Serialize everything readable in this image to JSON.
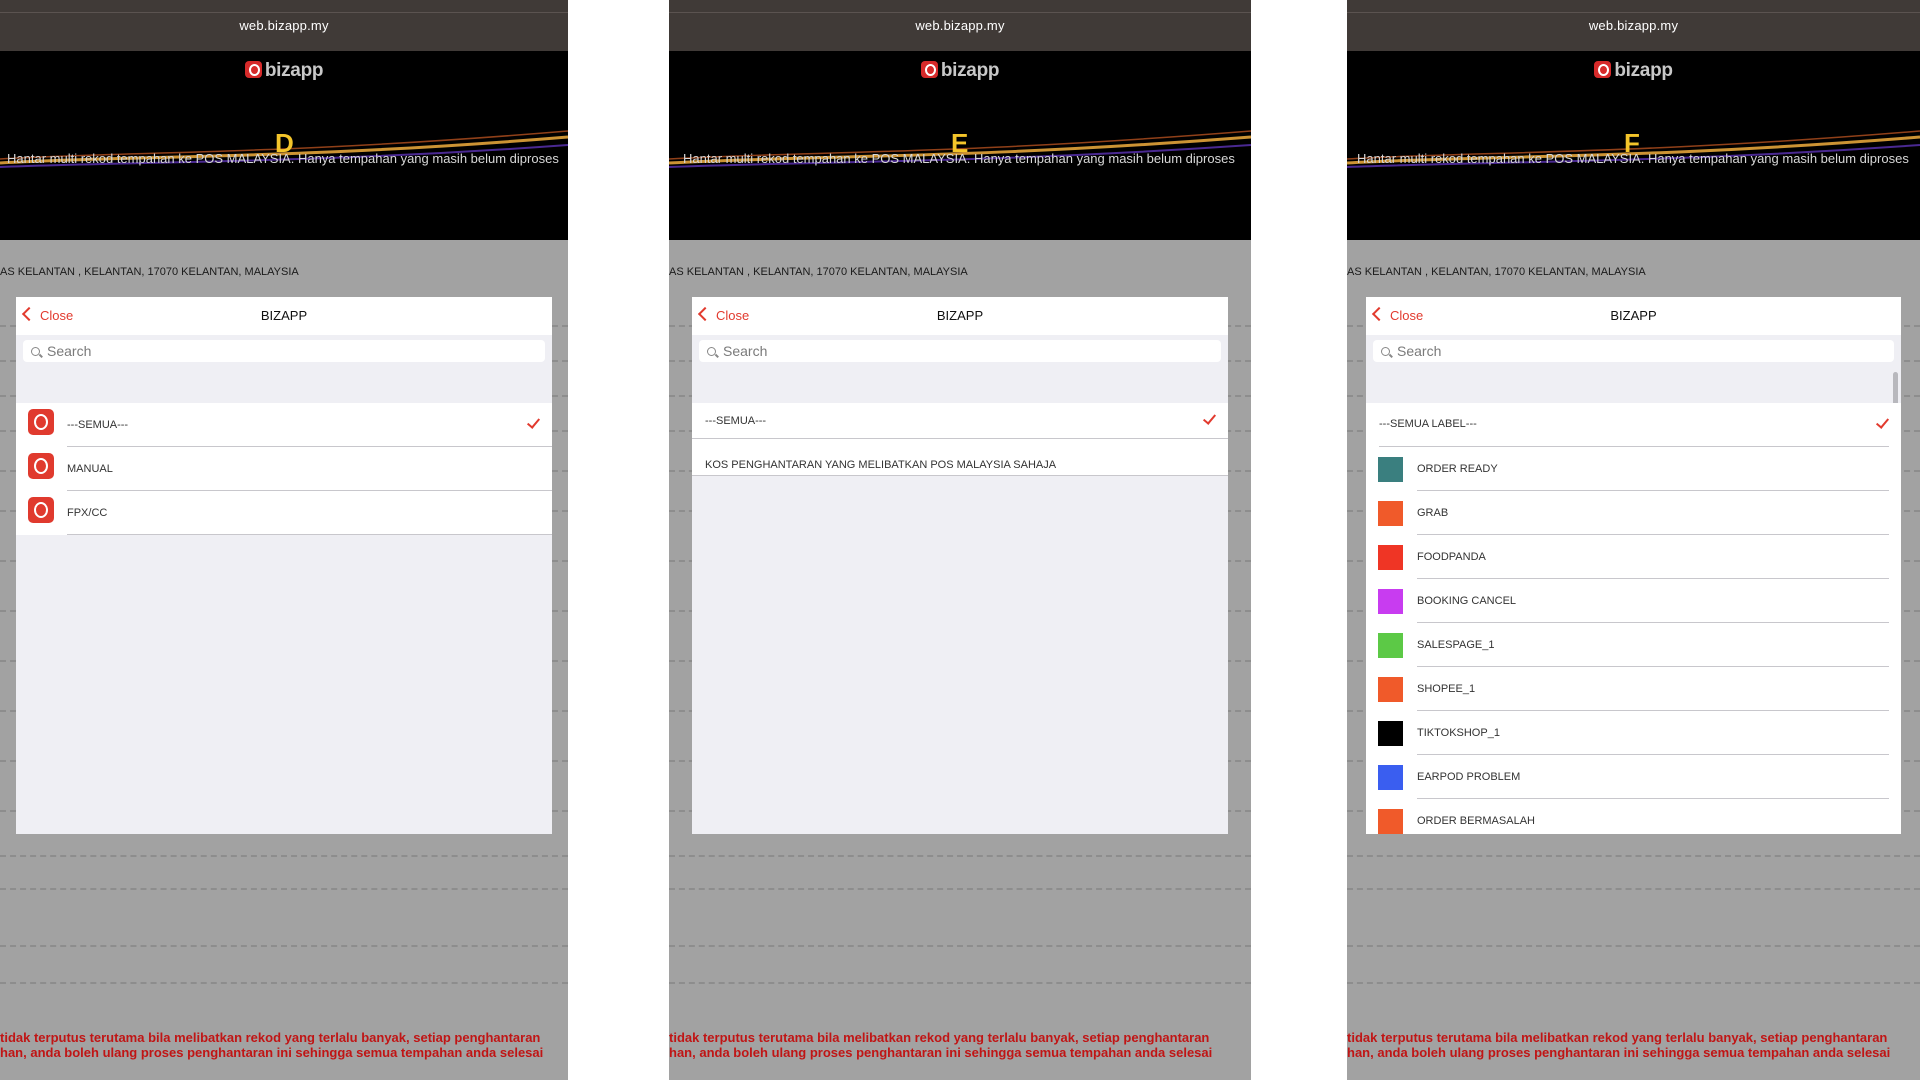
{
  "url": "web.bizapp.my",
  "logo_text": "bizapp",
  "banner_text": "Hantar multi rekod tempahan ke POS MALAYSIA. Hanya tempahan yang masih belum diproses",
  "address_text": "AS KELANTAN , KELANTAN, 17070 KELANTAN, MALAYSIA",
  "bottom_text_1": "tidak terputus terutama bila melibatkan rekod yang terlalu banyak, setiap penghantaran",
  "bottom_text_2": "han, anda boleh ulang proses penghantaran ini sehingga semua tempahan anda selesai",
  "panels": [
    {
      "letter": "D",
      "header": {
        "close_label": "Close",
        "title": "BIZAPP"
      },
      "search": {
        "placeholder": "Search"
      },
      "items": [
        {
          "label": "---SEMUA---",
          "icon": "bizapp-app-icon",
          "selected": true
        },
        {
          "label": "MANUAL",
          "icon": "bizapp-app-icon",
          "selected": false
        },
        {
          "label": "FPX/CC",
          "icon": "bizapp-app-icon",
          "selected": false
        }
      ]
    },
    {
      "letter": "E",
      "header": {
        "close_label": "Close",
        "title": "BIZAPP"
      },
      "search": {
        "placeholder": "Search"
      },
      "items": [
        {
          "label": "---SEMUA---",
          "selected": true
        },
        {
          "label": "KOS PENGHANTARAN YANG MELIBATKAN POS MALAYSIA SAHAJA",
          "selected": false
        }
      ]
    },
    {
      "letter": "F",
      "header": {
        "close_label": "Close",
        "title": "BIZAPP"
      },
      "search": {
        "placeholder": "Search"
      },
      "items": [
        {
          "label": "---SEMUA LABEL---",
          "selected": true
        },
        {
          "label": "ORDER READY",
          "color": "#3a7f7f"
        },
        {
          "label": "GRAB",
          "color": "#f05a2a"
        },
        {
          "label": "FOODPANDA",
          "color": "#ef3525"
        },
        {
          "label": "BOOKING CANCEL",
          "color": "#c83cf0"
        },
        {
          "label": "SALESPAGE_1",
          "color": "#5cc946"
        },
        {
          "label": "SHOPEE_1",
          "color": "#f05a2a"
        },
        {
          "label": "TIKTOKSHOP_1",
          "color": "#000000"
        },
        {
          "label": "EARPOD PROBLEM",
          "color": "#3a5ef0"
        },
        {
          "label": "ORDER BERMASALAH",
          "color": "#f05a2a"
        }
      ]
    }
  ]
}
